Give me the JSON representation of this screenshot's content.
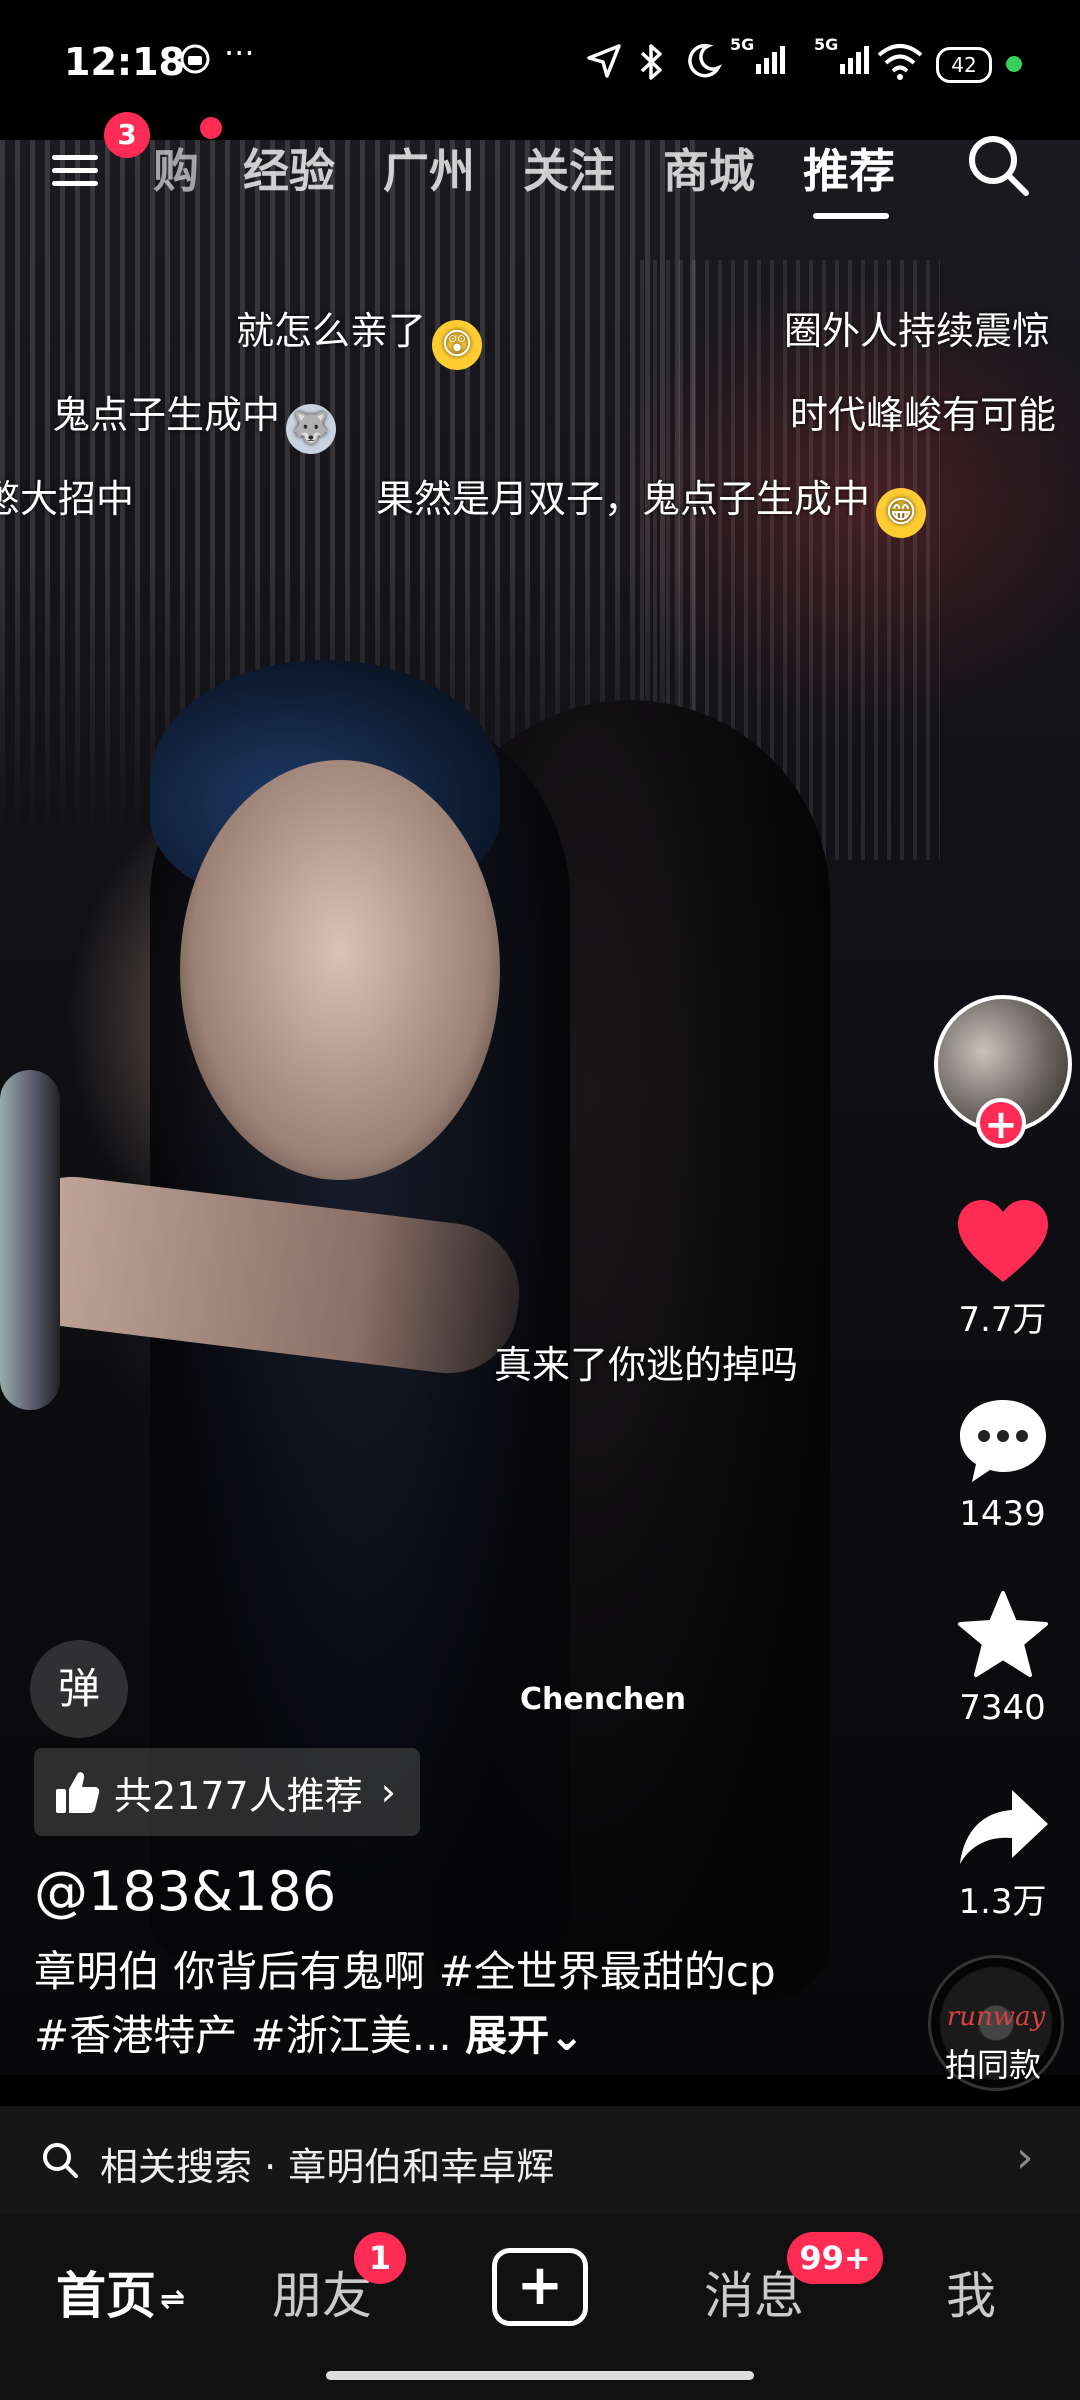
{
  "status_bar": {
    "time": "12:18",
    "more": "···",
    "signal1": "5G",
    "signal2": "5G",
    "battery": "42"
  },
  "top_nav": {
    "menu_badge": "3",
    "tabs": [
      "购",
      "经验",
      "广州",
      "关注",
      "商城",
      "推荐"
    ],
    "active_tab": "推荐"
  },
  "danmaku": [
    {
      "text": "就怎么亲了"
    },
    {
      "text": "圈外人持续震惊"
    },
    {
      "text": "鬼点子生成中"
    },
    {
      "text": "时代峰峻有可能"
    },
    {
      "text": "憋大招中"
    },
    {
      "text": "果然是月双子，鬼点子生成中"
    },
    {
      "text": "真来了你逃的掉吗"
    }
  ],
  "rail": {
    "likes": "7.7万",
    "comments": "1439",
    "favorites": "7340",
    "shares": "1.3万",
    "music_art": "runway",
    "music_label": "拍同款"
  },
  "video": {
    "danmaku_button": "弹",
    "watermark": "Chenchen",
    "recommend": "共2177人推荐",
    "author": "@183&186",
    "caption": "章明伯 你背后有鬼啊 #全世界最甜的cp #香港特产 #浙江美...",
    "expand": "展开"
  },
  "related_search": {
    "text": "相关搜索 · 章明伯和幸卓辉"
  },
  "bottom_nav": {
    "home": "首页",
    "friends": "朋友",
    "friends_badge": "1",
    "messages": "消息",
    "messages_badge": "99+",
    "me": "我"
  },
  "colors": {
    "accent": "#fe2c55",
    "like": "#fe2c55",
    "battery_dot": "#34d058"
  }
}
